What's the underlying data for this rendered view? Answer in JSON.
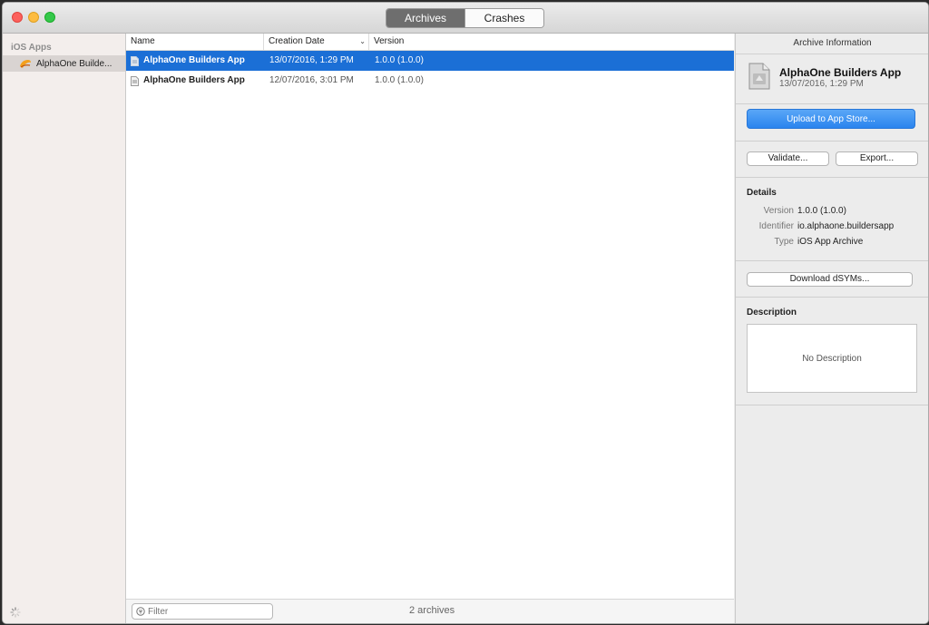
{
  "toolbar": {
    "tabs": [
      {
        "label": "Archives",
        "active": true
      },
      {
        "label": "Crashes",
        "active": false
      }
    ]
  },
  "sidebar": {
    "header": "iOS Apps",
    "items": [
      {
        "label": "AlphaOne Builde...",
        "icon": "app-icon",
        "selected": true
      }
    ]
  },
  "list": {
    "columns": [
      {
        "label": "Name"
      },
      {
        "label": "Creation Date",
        "sort": "descending"
      },
      {
        "label": "Version"
      }
    ],
    "rows": [
      {
        "name": "AlphaOne Builders App",
        "date": "13/07/2016, 1:29 PM",
        "version": "1.0.0 (1.0.0)",
        "selected": true
      },
      {
        "name": "AlphaOne Builders App",
        "date": "12/07/2016, 3:01 PM",
        "version": "1.0.0 (1.0.0)",
        "selected": false
      }
    ],
    "filter_placeholder": "Filter",
    "count": "2 archives"
  },
  "inspector": {
    "title": "Archive Information",
    "app_name": "AlphaOne Builders App",
    "app_date": "13/07/2016, 1:29 PM",
    "upload_label": "Upload to App Store...",
    "validate_label": "Validate...",
    "export_label": "Export...",
    "details_title": "Details",
    "details": [
      {
        "key": "Version",
        "value": "1.0.0 (1.0.0)"
      },
      {
        "key": "Identifier",
        "value": "io.alphaone.buildersapp"
      },
      {
        "key": "Type",
        "value": "iOS App Archive"
      }
    ],
    "dsym_label": "Download dSYMs...",
    "description_title": "Description",
    "description_text": "No Description"
  },
  "colors": {
    "selection": "#1b6fd6",
    "primary_button": "#2a84ee",
    "close": "#fc605c",
    "minimize": "#fdbc40",
    "maximize": "#34c84a"
  }
}
